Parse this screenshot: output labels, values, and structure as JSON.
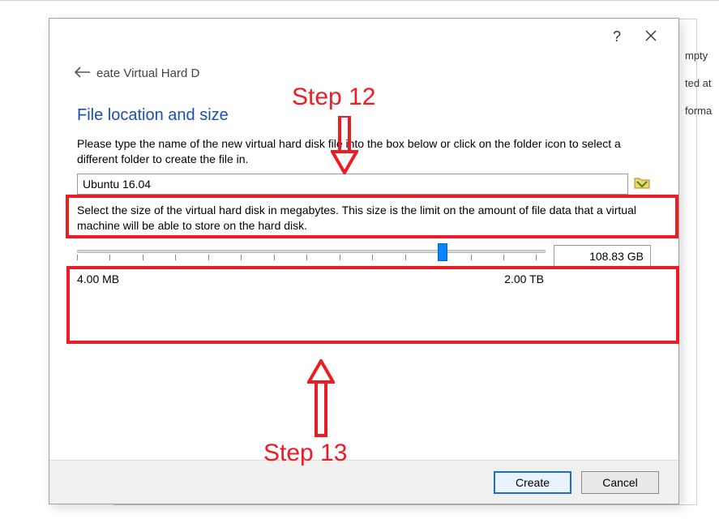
{
  "background": {
    "snip1": "mpty",
    "snip2": "ted at",
    "snip3": "forma"
  },
  "dialog": {
    "breadcrumb_prefix": "eate Virtual Hard D",
    "title": "File location and size",
    "desc_location": "Please type the name of the new virtual hard disk file into the box below or click on the folder icon to select a different folder to create the file in.",
    "file_value": "Ubuntu 16.04",
    "desc_size": "Select the size of the virtual hard disk in megabytes. This size is the limit on the amount of file data that a virtual machine will be able to store on the hard disk.",
    "slider": {
      "min_label": "4.00 MB",
      "max_label": "2.00 TB",
      "value_label": "108.83 GB",
      "thumb_percent": 78
    },
    "buttons": {
      "create": "Create",
      "cancel": "Cancel"
    }
  },
  "annotations": {
    "step12": "Step 12",
    "step13": "Step 13"
  }
}
